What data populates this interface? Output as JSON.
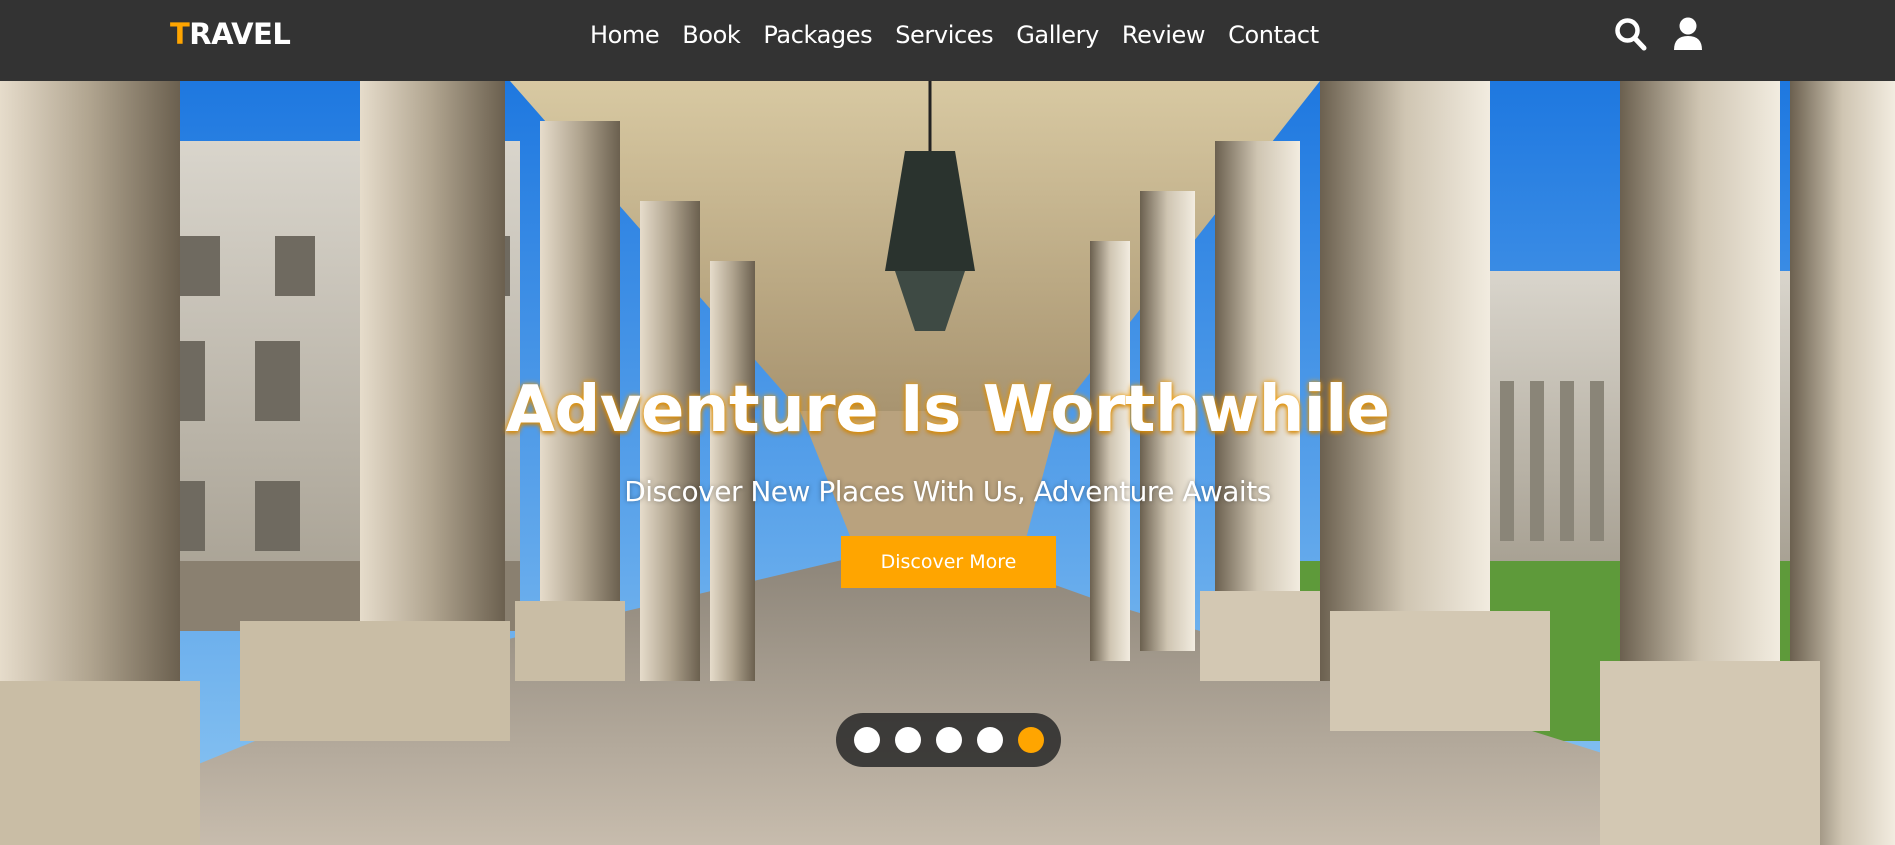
{
  "brand": {
    "first_letter": "T",
    "rest": "RAVEL"
  },
  "nav": {
    "items": [
      {
        "label": "Home"
      },
      {
        "label": "Book"
      },
      {
        "label": "Packages"
      },
      {
        "label": "Services"
      },
      {
        "label": "Gallery"
      },
      {
        "label": "Review"
      },
      {
        "label": "Contact"
      }
    ],
    "icons": [
      "search-icon",
      "user-icon"
    ]
  },
  "hero": {
    "title": "Adventure Is Worthwhile",
    "subtitle": "Discover New Places With Us, Adventure Awaits",
    "button_label": "Discover More"
  },
  "slider": {
    "slide_count": 5,
    "active_index": 5
  },
  "colors": {
    "nav_bg": "#333333",
    "accent": "#ffa500",
    "text": "#ffffff"
  }
}
